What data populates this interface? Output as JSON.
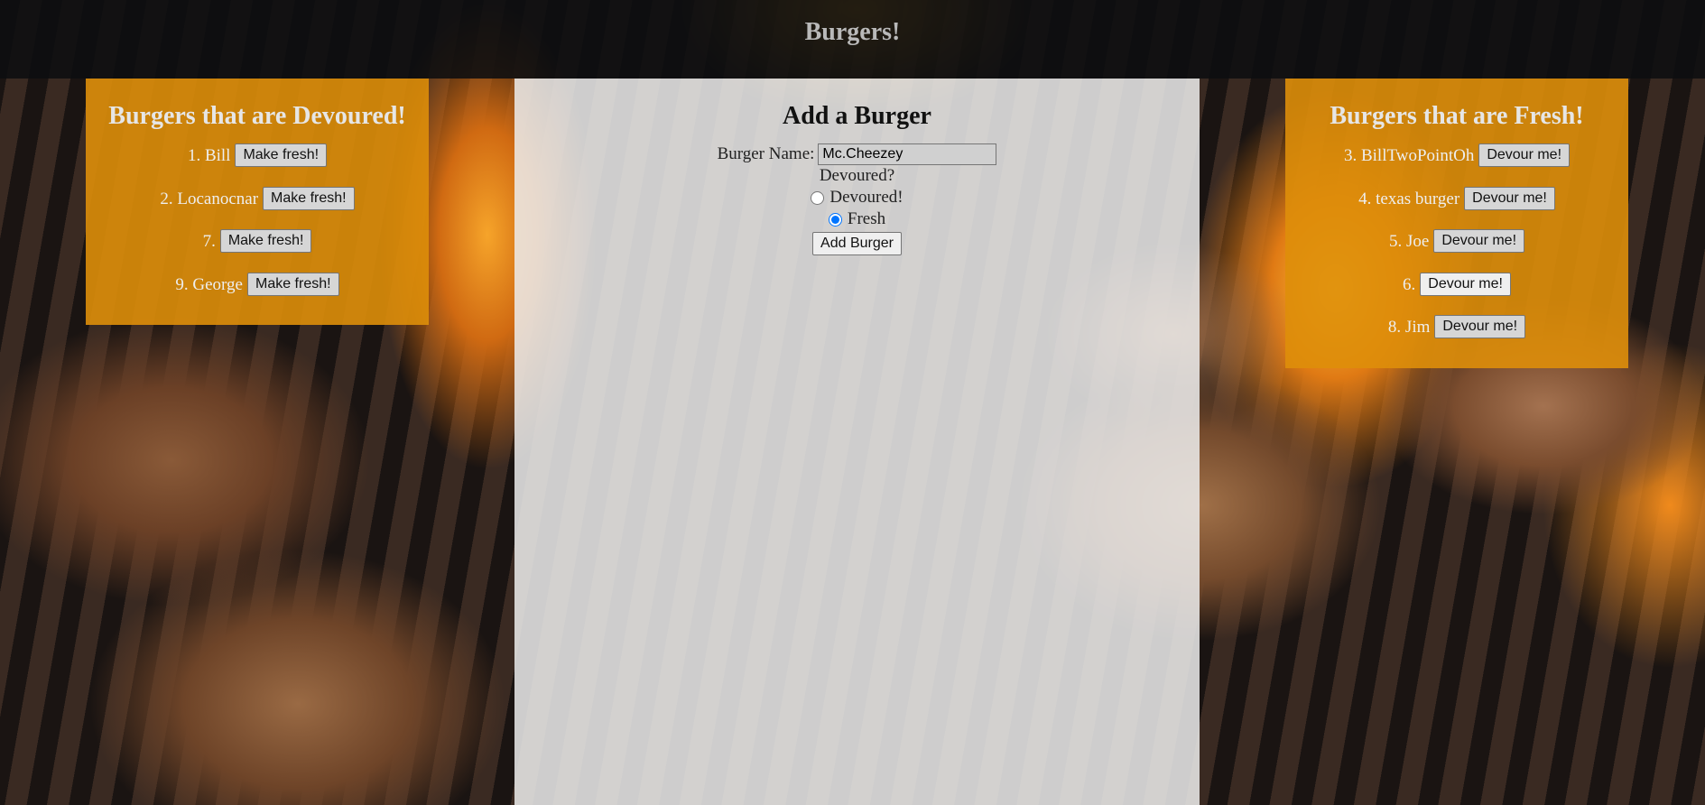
{
  "header": {
    "title": "Burgers!"
  },
  "devoured": {
    "title": "Burgers that are Devoured!",
    "button_label": "Make fresh!",
    "items": [
      {
        "label": "1. Bill"
      },
      {
        "label": "2. Locanocnar"
      },
      {
        "label": "7."
      },
      {
        "label": "9. George"
      }
    ]
  },
  "add": {
    "title": "Add a Burger",
    "name_label": "Burger Name:",
    "name_value": "Mc.Cheezey",
    "devoured_question": "Devoured?",
    "option_devoured": "Devoured!",
    "option_fresh": "Fresh",
    "selected_option": "Fresh",
    "submit_label": "Add Burger"
  },
  "fresh": {
    "title": "Burgers that are Fresh!",
    "button_label": "Devour me!",
    "items": [
      {
        "label": "3. BillTwoPointOh"
      },
      {
        "label": "4. texas burger"
      },
      {
        "label": "5. Joe"
      },
      {
        "label": "6."
      },
      {
        "label": "8. Jim"
      }
    ]
  },
  "colors": {
    "header_bg": "#0c0e10",
    "panel_orange": "#de8e0a",
    "panel_light": "#ececec"
  }
}
